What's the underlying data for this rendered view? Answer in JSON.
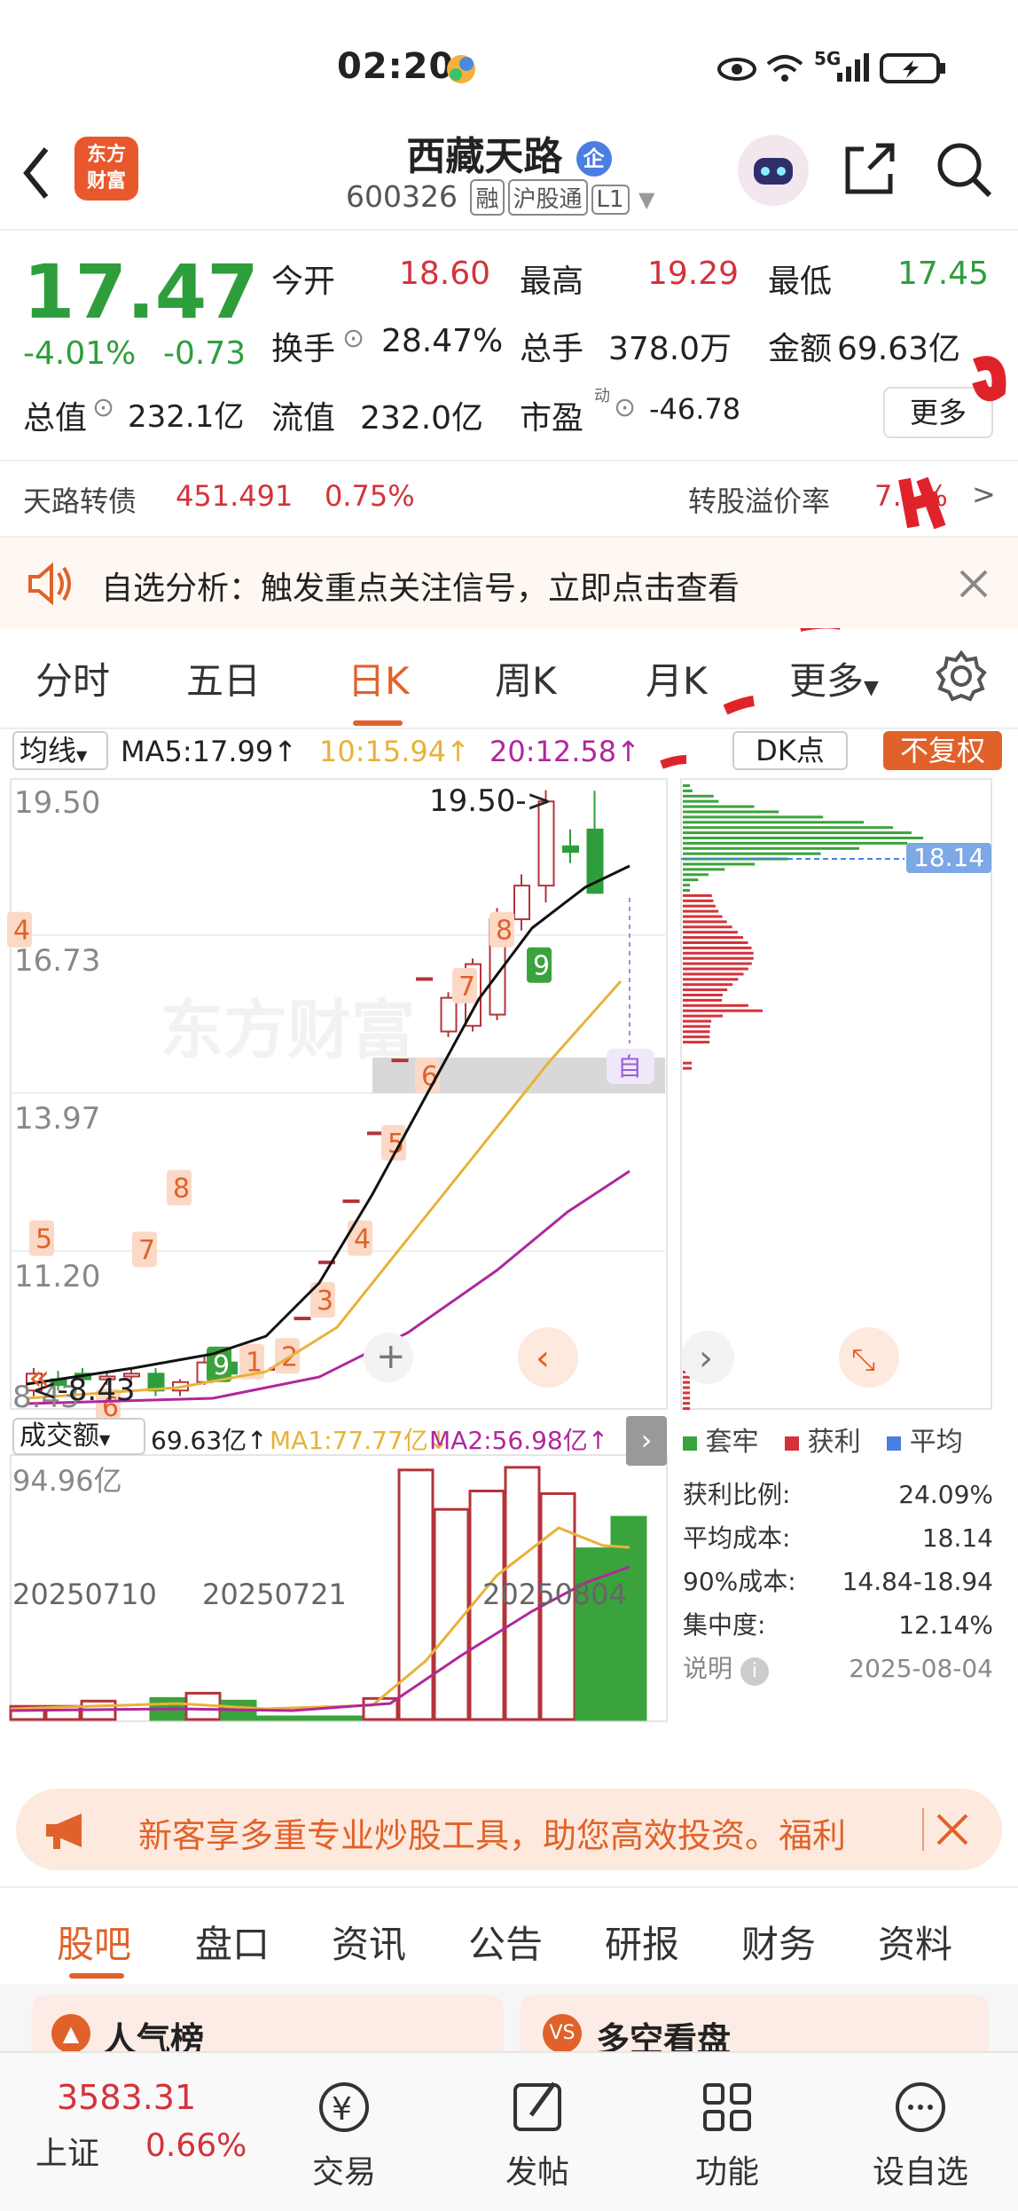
{
  "status": {
    "time": "02:20",
    "net": "5G"
  },
  "header": {
    "title": "西藏天路",
    "badge": "企",
    "code": "600326",
    "tags": [
      "融",
      "沪股通",
      "L1"
    ],
    "logo": "东方\n财富"
  },
  "quote": {
    "price": "17.47",
    "pct": "-4.01%",
    "chg": "-0.73",
    "open_label": "今开",
    "open": "18.60",
    "high_label": "最高",
    "high": "19.29",
    "low_label": "最低",
    "low": "17.45",
    "turnover_label": "换手",
    "turnover": "28.47%",
    "vol_label": "总手",
    "vol": "378.0万",
    "amount_label": "金额",
    "amount": "69.63亿",
    "mktcap_label": "总值",
    "mktcap": "232.1亿",
    "float_label": "流值",
    "float": "232.0亿",
    "pe_label": "市盈",
    "pe_sup": "动",
    "pe": "-46.78",
    "more": "更多"
  },
  "bond": {
    "name": "天路转债",
    "price": "451.491",
    "pct": "0.75%",
    "premium_label": "转股溢价率",
    "premium": "7…%"
  },
  "banner": {
    "text": "自选分析：触发重点关注信号，立即点击查看"
  },
  "tabs": [
    "分时",
    "五日",
    "日K",
    "周K",
    "月K",
    "更多"
  ],
  "active_tab": "日K",
  "ma": {
    "selector": "均线",
    "ma5": "MA5:17.99↑",
    "ma10": "10:15.94↑",
    "ma20": "20:12.58↑",
    "dk": "DK点",
    "fq": "不复权"
  },
  "kline": {
    "yticks": [
      "19.50",
      "16.73",
      "13.97",
      "11.20",
      "8.43"
    ],
    "high_note": "19.50->",
    "low_note": "<-8.43",
    "watermark": "东方财富",
    "cost_price": "18.14",
    "self_mark": "自",
    "td_labels": [
      "4",
      "5",
      "6",
      "7",
      "8",
      "9",
      "1",
      "2",
      "3",
      "4",
      "5",
      "6",
      "7",
      "8",
      "9"
    ]
  },
  "volume": {
    "selector": "成交额",
    "val": "69.63亿↑",
    "ma1": "MA1:77.77亿↓",
    "ma2": "MA2:56.98亿↑",
    "ymax": "94.96亿",
    "dates": [
      "20250710",
      "20250721",
      "20250804"
    ]
  },
  "chips": {
    "legend": [
      "套牢",
      "获利",
      "平均"
    ],
    "rows": [
      {
        "label": "获利比例:",
        "value": "24.09%"
      },
      {
        "label": "平均成本:",
        "value": "18.14"
      },
      {
        "label": "90%成本:",
        "value": "14.84-18.94"
      },
      {
        "label": "集中度:",
        "value": "12.14%"
      }
    ],
    "note_label": "说明",
    "date": "2025-08-04"
  },
  "promo": {
    "text": "新客享多重专业炒股工具，助您高效投资。福利"
  },
  "subtabs": [
    "股吧",
    "盘口",
    "资讯",
    "公告",
    "研报",
    "财务",
    "资料"
  ],
  "cards": [
    "人气榜",
    "多空看盘"
  ],
  "bottom": {
    "index_price": "3583.31",
    "index_name": "上证",
    "index_pct": "0.66%",
    "items": [
      "交易",
      "发帖",
      "功能",
      "设自选"
    ]
  }
}
